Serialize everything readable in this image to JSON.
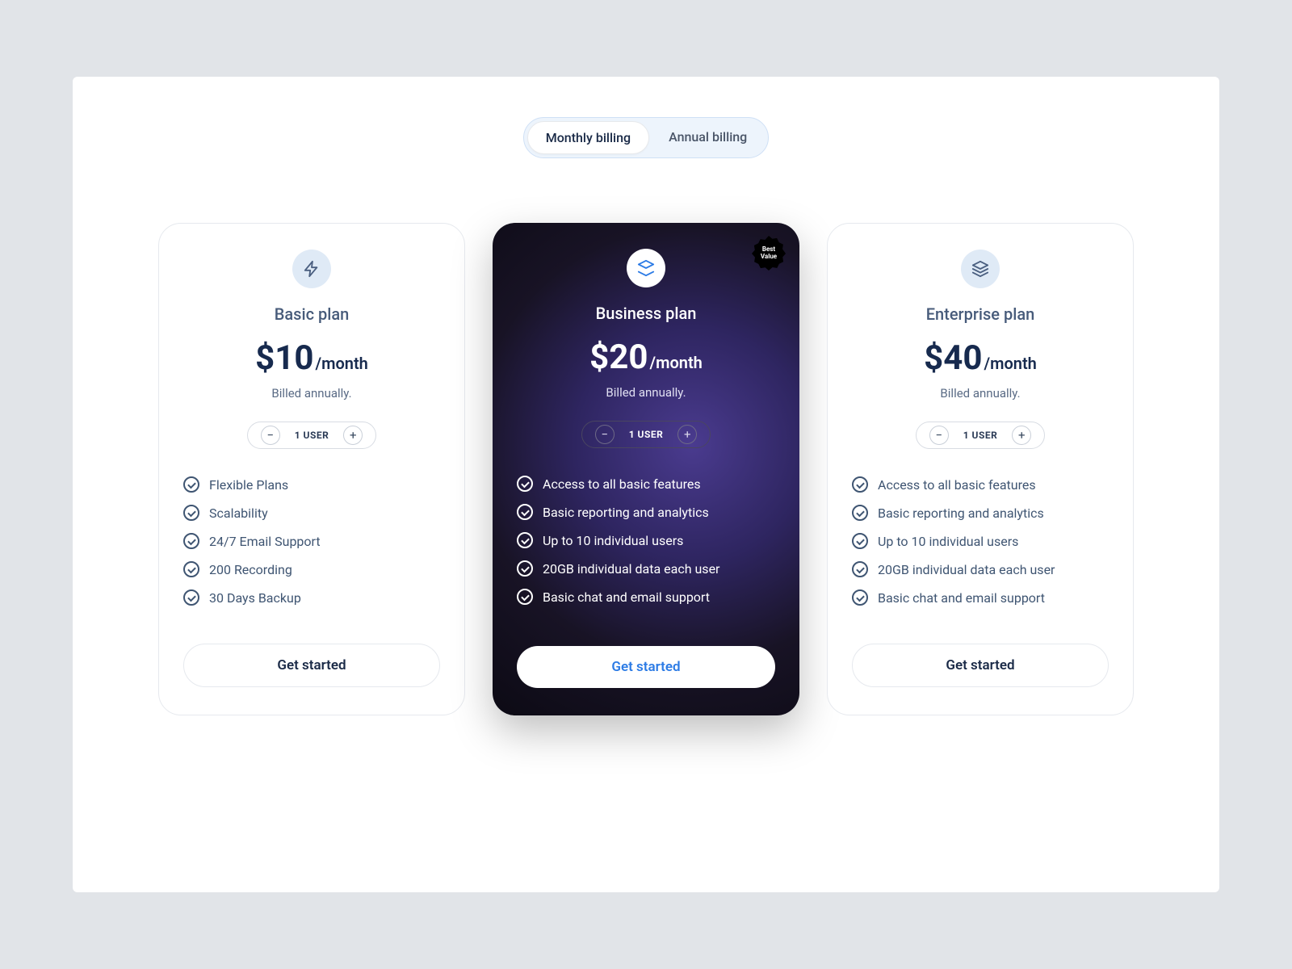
{
  "toggle": {
    "monthly": "Monthly billing",
    "annual": "Annual billing",
    "active": "monthly"
  },
  "badge": {
    "line1": "Best",
    "line2": "Value"
  },
  "plans": [
    {
      "name": "Basic plan",
      "price": "$10",
      "unit": "/month",
      "billed": "Billed annually.",
      "users": "1 USER",
      "cta": "Get started",
      "features": [
        "Flexible Plans",
        "Scalability",
        "24/7 Email Support",
        "200 Recording",
        "30 Days Backup"
      ]
    },
    {
      "name": "Business plan",
      "price": "$20",
      "unit": "/month",
      "billed": "Billed annually.",
      "users": "1 USER",
      "cta": "Get started",
      "features": [
        "Access to all basic features",
        "Basic reporting and analytics",
        "Up to 10 individual users",
        "20GB individual data each user",
        "Basic chat and email support"
      ]
    },
    {
      "name": "Enterprise plan",
      "price": "$40",
      "unit": "/month",
      "billed": "Billed annually.",
      "users": "1 USER",
      "cta": "Get started",
      "features": [
        "Access to all basic features",
        "Basic reporting and analytics",
        "Up to 10 individual users",
        "20GB individual data each user",
        "Basic chat and email support"
      ]
    }
  ]
}
